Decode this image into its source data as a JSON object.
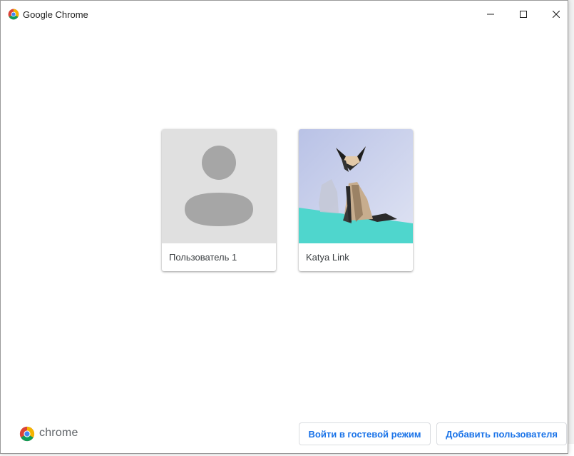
{
  "window": {
    "title": "Google Chrome",
    "controls": [
      "minimize",
      "maximize",
      "close"
    ]
  },
  "profiles": [
    {
      "name": "Пользователь 1",
      "avatar": "default-person-avatar"
    },
    {
      "name": "Katya Link",
      "avatar": "origami-cat-avatar"
    }
  ],
  "footer": {
    "brand_text": "chrome",
    "guest_button": "Войти в гостевой режим",
    "add_user_button": "Добавить пользователя"
  },
  "colors": {
    "accent": "#1a73e8",
    "placeholder_bg": "#e0e0e0",
    "placeholder_fg": "#a6a6a6",
    "teal": "#4fd6cd"
  }
}
